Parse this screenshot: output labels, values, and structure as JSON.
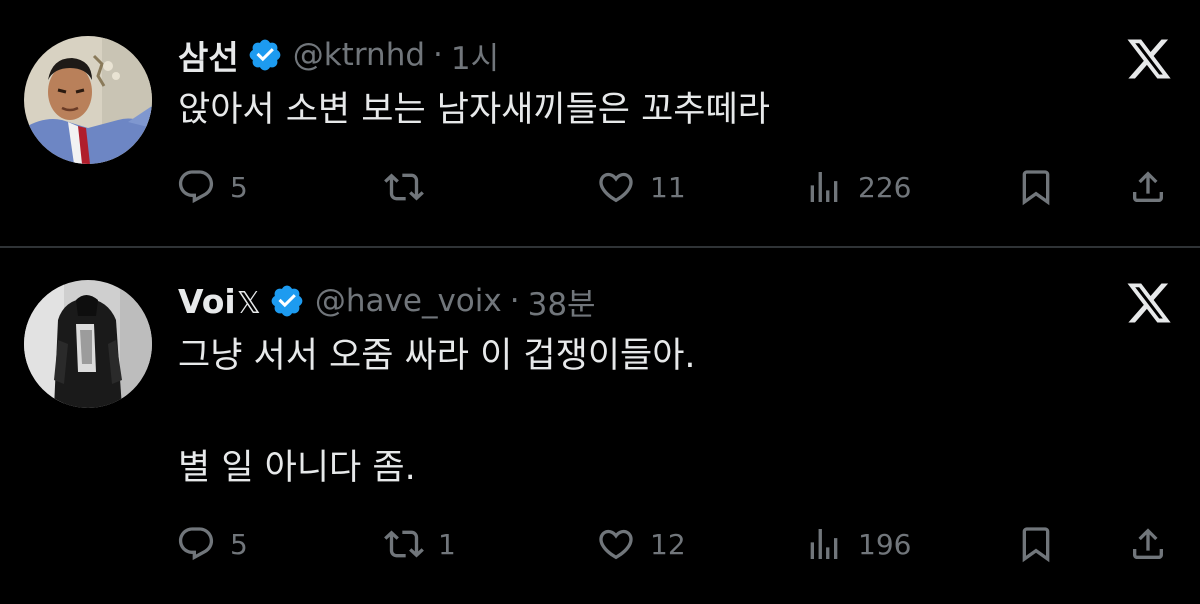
{
  "colors": {
    "background": "#000000",
    "text_primary": "#e7e9ea",
    "text_secondary": "#71767b",
    "verified_badge": "#1d9bf0",
    "divider": "#2f3336"
  },
  "tweets": [
    {
      "display_name": "삼선",
      "name_suffix": "",
      "handle": "@ktrnhd",
      "separator": "·",
      "time": "1시",
      "verified": true,
      "avatar_icon": "avatar-photo",
      "brand_icon": "x-logo-icon",
      "text_lines": [
        "앉아서 소변 보는 남자새끼들은 꼬추떼라"
      ],
      "actions": {
        "reply_icon": "reply-icon",
        "replies": "5",
        "retweet_icon": "retweet-icon",
        "retweets": "",
        "like_icon": "heart-icon",
        "likes": "11",
        "views_icon": "views-icon",
        "views": "226",
        "bookmark_icon": "bookmark-icon",
        "share_icon": "share-icon"
      }
    },
    {
      "display_name": "Voi",
      "name_suffix": "𝕏",
      "handle": "@have_voix",
      "separator": "·",
      "time": "38분",
      "verified": true,
      "avatar_icon": "avatar-photo",
      "brand_icon": "x-logo-icon",
      "text_lines": [
        "그냥 서서 오줌 싸라 이 겁쟁이들아.",
        "별 일 아니다 좀."
      ],
      "actions": {
        "reply_icon": "reply-icon",
        "replies": "5",
        "retweet_icon": "retweet-icon",
        "retweets": "1",
        "like_icon": "heart-icon",
        "likes": "12",
        "views_icon": "views-icon",
        "views": "196",
        "bookmark_icon": "bookmark-icon",
        "share_icon": "share-icon"
      }
    }
  ]
}
